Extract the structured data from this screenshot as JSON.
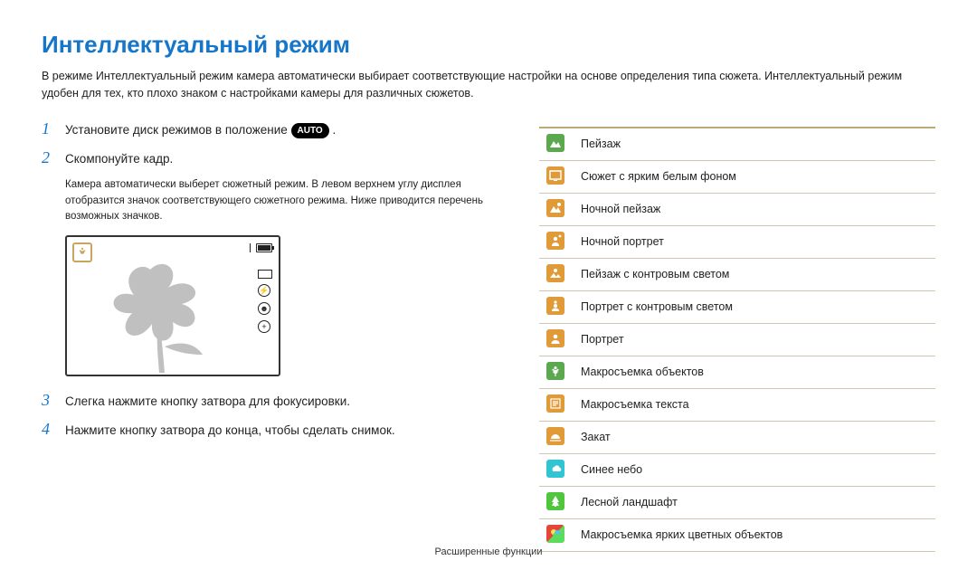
{
  "title": "Интеллектуальный режим",
  "intro": "В режиме Интеллектуальный режим камера автоматически выбирает соответствующие настройки на основе определения типа сюжета. Интеллектуальный режим удобен для тех, кто плохо знаком с настройками камеры для различных сюжетов.",
  "auto_badge": "AUTO",
  "steps": {
    "s1": {
      "num": "1",
      "text_a": "Установите диск режимов в положение ",
      "text_b": "."
    },
    "s2": {
      "num": "2",
      "text": "Скомпонуйте кадр."
    },
    "s2_note": "Камера автоматически выберет сюжетный режим. В левом верхнем углу дисплея отобразится значок соответствующего сюжетного режима. Ниже приводится перечень возможных значков.",
    "s3": {
      "num": "3",
      "text": "Слегка нажмите кнопку затвора для фокусировки."
    },
    "s4": {
      "num": "4",
      "text": "Нажмите кнопку затвора до конца, чтобы сделать снимок."
    }
  },
  "scenes": [
    {
      "label": "Пейзаж",
      "bg": "#5ba84f"
    },
    {
      "label": "Сюжет с ярким белым фоном",
      "bg": "#e09a37"
    },
    {
      "label": "Ночной пейзаж",
      "bg": "#e09a37"
    },
    {
      "label": "Ночной портрет",
      "bg": "#e09a37"
    },
    {
      "label": "Пейзаж с контровым светом",
      "bg": "#e09a37"
    },
    {
      "label": "Портрет с контровым светом",
      "bg": "#e09a37"
    },
    {
      "label": "Портрет",
      "bg": "#e09a37"
    },
    {
      "label": "Макросъемка объектов",
      "bg": "#5ba84f"
    },
    {
      "label": "Макросъемка текста",
      "bg": "#e09a37"
    },
    {
      "label": "Закат",
      "bg": "#e09a37"
    },
    {
      "label": "Синее небо",
      "bg": "#2fc5d2"
    },
    {
      "label": "Лесной ландшафт",
      "bg": "#4fc63c"
    },
    {
      "label": "Макросъемка ярких цветных объектов",
      "bg": "#e6453a",
      "multi": true
    }
  ],
  "footer": "Расширенные функции"
}
